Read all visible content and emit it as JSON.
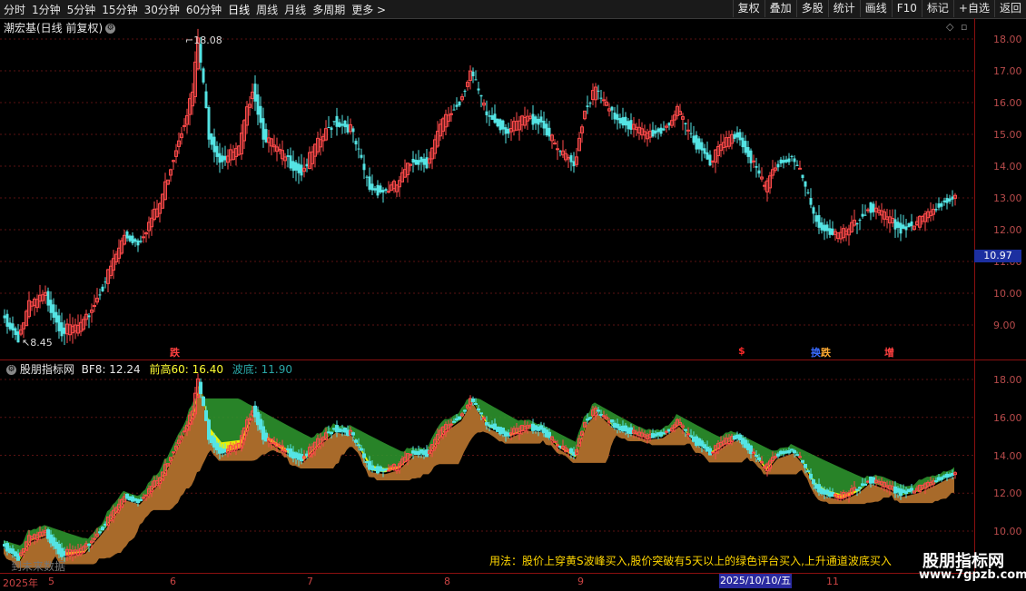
{
  "toolbar": {
    "periods": [
      "分时",
      "1分钟",
      "5分钟",
      "15分钟",
      "30分钟",
      "60分钟",
      "日线",
      "周线",
      "月线",
      "多周期",
      "更多"
    ],
    "active_period": "日线",
    "more_arrow": ">",
    "right_buttons": [
      "复权",
      "叠加",
      "多股",
      "统计",
      "画线",
      "F10",
      "标记",
      "+自选",
      "返回"
    ]
  },
  "price_panel": {
    "title": "潮宏基(日线 前复权)",
    "high_label": "18.08",
    "low_label": "8.45",
    "current_price": "10.97",
    "y_ticks": [
      "18.00",
      "17.00",
      "16.00",
      "15.00",
      "14.00",
      "13.00",
      "12.00",
      "11.00",
      "10.00",
      "9.00"
    ],
    "signals": [
      {
        "text": "跌",
        "color": "#ff4040"
      },
      {
        "text": "$",
        "color": "#ff2a2a"
      },
      {
        "text": "换",
        "color": "#3a6bff"
      },
      {
        "text": "跌",
        "color": "#ffaa33"
      },
      {
        "text": "增",
        "color": "#ff4040"
      }
    ]
  },
  "indicator_panel": {
    "name": "股朋指标网",
    "bf8_label": "BF8: 12.24",
    "prev_high_label": "前高60: 16.40",
    "trough_label": "波底: 11.90",
    "y_ticks": [
      "18.00",
      "16.00",
      "14.00",
      "12.00",
      "10.00"
    ],
    "usage_text": "用法：股价上穿黄S波峰买入,股价突破有5天以上的绿色评台买入,上升通道波底买入",
    "no_data_text": "到未来数据"
  },
  "x_axis": {
    "labels": [
      "2025年",
      "5",
      "6",
      "7",
      "8",
      "9",
      "2025/10/10/五",
      "11"
    ],
    "highlight_date": "2025/10/10/五"
  },
  "watermark": {
    "name": "股朋指标网",
    "url": "www.7gpzb.com"
  },
  "colors": {
    "up": "#ff4a4a",
    "down": "#54e4e4",
    "green_band": "#2f9a2f",
    "yellow_band": "#ffff00",
    "brown_band": "#a86a2a"
  }
}
